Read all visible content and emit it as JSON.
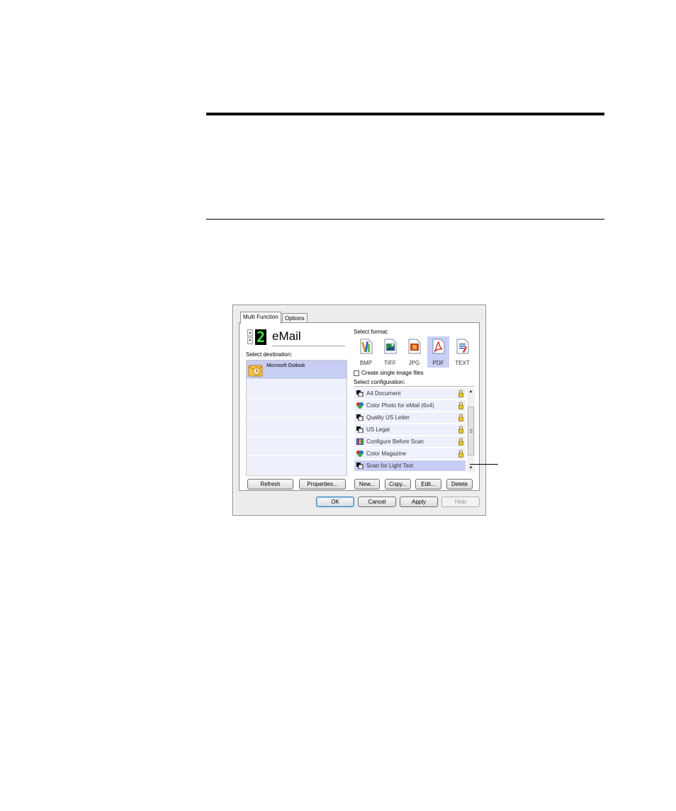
{
  "dialog": {
    "tabs": [
      {
        "label": "Multi Function"
      },
      {
        "label": "Options"
      }
    ],
    "destination": {
      "number": "2",
      "name": "eMail",
      "select_label": "Select destination:",
      "items": [
        {
          "label": "Microsoft Outlook",
          "icon": "outlook-icon",
          "selected": true
        }
      ]
    },
    "format": {
      "select_label": "Select format:",
      "options": [
        {
          "label": "BMP",
          "selected": false
        },
        {
          "label": "TIFF",
          "selected": false
        },
        {
          "label": "JPG",
          "selected": false
        },
        {
          "label": "PDF",
          "selected": true
        },
        {
          "label": "TEXT",
          "selected": false
        }
      ],
      "single_image_label": "Create single image files"
    },
    "configuration": {
      "select_label": "Select configuration:",
      "items": [
        {
          "label": "A4 Document",
          "icon": "bw-page-icon",
          "locked": true
        },
        {
          "label": "Color Photo for eMail (6x4)",
          "icon": "color-photo-icon",
          "locked": true
        },
        {
          "label": "Quality US Letter",
          "icon": "bw-page-icon",
          "locked": true
        },
        {
          "label": "US Legal",
          "icon": "bw-page-icon",
          "locked": true
        },
        {
          "label": "Configure Before Scan",
          "icon": "configure-icon",
          "locked": true
        },
        {
          "label": "Color Magazine",
          "icon": "color-photo-icon",
          "locked": true
        },
        {
          "label": "Scan for Light Text",
          "icon": "bw-page-icon",
          "locked": false,
          "selected": true
        }
      ]
    },
    "buttons": {
      "refresh": "Refresh",
      "properties": "Properties...",
      "new": "New...",
      "copy": "Copy...",
      "edit": "Edit...",
      "delete": "Delete",
      "ok": "OK",
      "cancel": "Cancel",
      "apply": "Apply",
      "help": "Help"
    }
  }
}
